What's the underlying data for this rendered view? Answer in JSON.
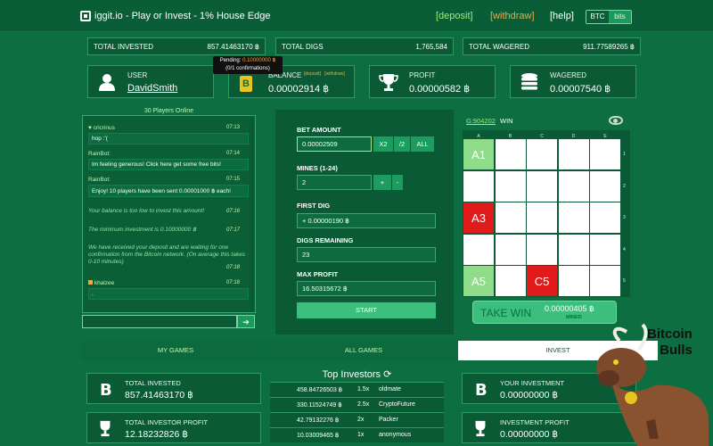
{
  "header": {
    "title": "iggit.io - Play or Invest - 1% House Edge",
    "deposit": "[deposit]",
    "withdraw": "[withdraw]",
    "help": "[help]",
    "unit_btc": "BTC",
    "unit_bits": "bits"
  },
  "stats": {
    "total_invested_label": "TOTAL INVESTED",
    "total_invested_value": "857.41463170 ฿",
    "total_digs_label": "TOTAL DIGS",
    "total_digs_value": "1,765,584",
    "total_wagered_label": "TOTAL WAGERED",
    "total_wagered_value": "911.77589265 ฿"
  },
  "account": {
    "user_label": "USER",
    "username": "DavidSmith",
    "balance_label": "BALANCE",
    "balance_deposit": "[deposit]",
    "balance_withdraw": "[withdraw]",
    "balance_value": "0.00002914 ฿",
    "profit_label": "PROFIT",
    "profit_value": "0.00000582 ฿",
    "wagered_label": "WAGERED",
    "wagered_value": "0.00007540 ฿",
    "tooltip_line1": "Pending:",
    "tooltip_amount": "0.10000000 ฿",
    "tooltip_line2": "(0/1 confirmations)"
  },
  "chat": {
    "players_online": "30 Players Online",
    "messages": [
      {
        "who": "cricrinus",
        "time": "07:13",
        "text": "hop :'("
      },
      {
        "who": "RainBot:",
        "time": "07:14",
        "text": "Im feeling generous! Click here get some free bits!"
      },
      {
        "who": "RainBot:",
        "time": "07:15",
        "text": "Enjoy! 10 players have been sent 0.00001000 ฿ each!"
      }
    ],
    "system": [
      {
        "text": "Your balance is too low to invest this amount!",
        "time": "07:16"
      },
      {
        "text": "The minimum investment is 0.10000000 ฿",
        "time": "07:17"
      },
      {
        "text": "We have received your deposit and are waiting for one confirmation from the Bitcoin network. (On average this takes 0-10 minutes)",
        "time": "07:18"
      }
    ],
    "last_message": {
      "who": "khalzee",
      "time": "07:18",
      "text": "."
    },
    "send_icon": "arrow-right-icon"
  },
  "bet": {
    "bet_amount_label": "BET AMOUNT",
    "bet_amount_value": "0.00002509",
    "x2": "X2",
    "half": "/2",
    "all": "ALL",
    "mines_label": "MINES (1-24)",
    "mines_value": "2",
    "plus": "+",
    "minus": "-",
    "first_dig_label": "FIRST DIG",
    "first_dig_value": "+ 0.00000190 ฿",
    "digs_remaining_label": "DIGS REMAINING",
    "digs_remaining_value": "23",
    "max_profit_label": "MAX PROFIT",
    "max_profit_value": "16.50315672 ฿",
    "start": "START"
  },
  "game": {
    "game_id": "G:904202",
    "status": "WIN",
    "col_labels": [
      "A",
      "B",
      "C",
      "D",
      "E"
    ],
    "row_labels": [
      "1",
      "2",
      "3",
      "4",
      "5"
    ],
    "revealed": [
      {
        "label": "A1",
        "type": "gem",
        "row": 0,
        "col": 0
      },
      {
        "label": "A3",
        "type": "mine",
        "row": 2,
        "col": 0
      },
      {
        "label": "A5",
        "type": "gem",
        "row": 4,
        "col": 0
      },
      {
        "label": "C5",
        "type": "mine",
        "row": 4,
        "col": 2
      }
    ],
    "take_win_label": "TAKE WIN",
    "take_win_amount": "0.00000405 ฿",
    "take_win_sub": "MINED"
  },
  "tabs": {
    "my_games": "MY GAMES",
    "all_games": "ALL GAMES",
    "invest": "INVEST"
  },
  "invest": {
    "total_invested_label": "TOTAL INVESTED",
    "total_invested_value": "857.41463170 ฿",
    "total_profit_label": "TOTAL INVESTOR PROFIT",
    "total_profit_value": "12.18232826 ฿",
    "your_investment_label": "YOUR INVESTMENT",
    "your_investment_value": "0.00000000 ฿",
    "investment_profit_label": "INVESTMENT PROFIT",
    "investment_profit_value": "0.00000000 ฿",
    "top_investors_title": "Top Investors",
    "top_investors": [
      {
        "amount": "458.84726503 ฿",
        "mult": "1.5x",
        "name": "oldmate"
      },
      {
        "amount": "330.11524749 ฿",
        "mult": "2.5x",
        "name": "CryptoFuture"
      },
      {
        "amount": "42.79132276 ฿",
        "mult": "2x",
        "name": "Packer"
      },
      {
        "amount": "10.03009465 ฿",
        "mult": "1x",
        "name": "anonymous"
      }
    ]
  },
  "branding": {
    "bull_line1": "Bitcoin",
    "bull_line2": "Bulls"
  }
}
